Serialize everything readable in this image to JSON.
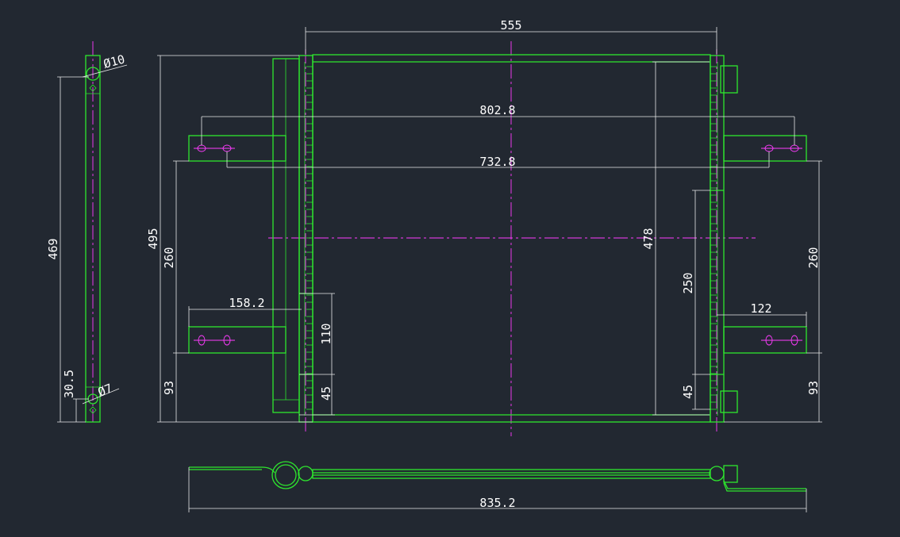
{
  "colors": {
    "background": "#222831",
    "outline": "#2ee62e",
    "dimension": "#e8e8e8",
    "centerline": "#ff3cff"
  },
  "dimensions": {
    "top_width": "555",
    "bracket_span_outer": "802.8",
    "bracket_span_inner": "732.8",
    "total_length": "835.2",
    "height_total": "495",
    "core_height": "478",
    "bracket_upper_left": "260",
    "bracket_upper_right": "260",
    "bracket_lower_left": "93",
    "bracket_lower_right": "93",
    "left_bracket_offset": "158.2",
    "right_bracket_offset": "122",
    "tank_110": "110",
    "tank_45_left": "45",
    "tank_250": "250",
    "tank_45_right": "45",
    "side_height": "469",
    "side_bottom_offset": "30.5",
    "hole_upper": "Ø10",
    "hole_lower": "Ø7"
  }
}
